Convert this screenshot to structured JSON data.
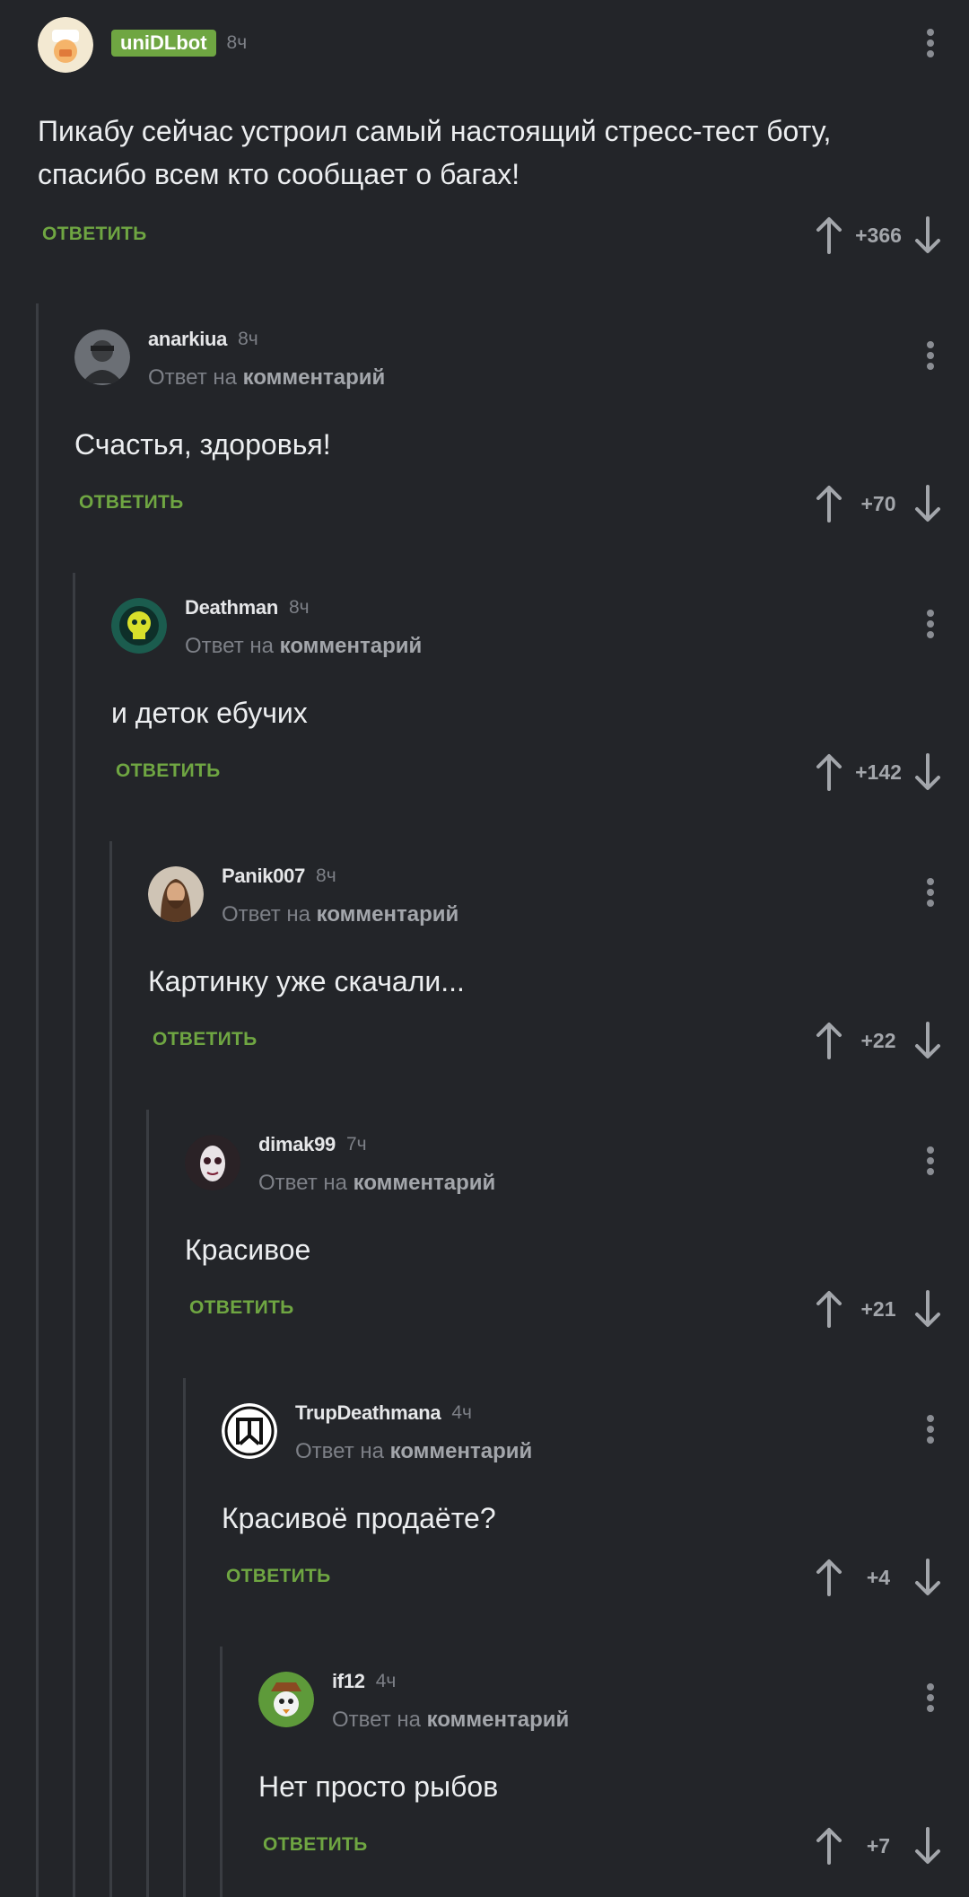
{
  "reply_label": "ОТВЕТИТЬ",
  "reply_to_prefix": "Ответ на",
  "reply_to_link": "комментарий",
  "comments": [
    {
      "author": "uniDLbot",
      "time": "8ч",
      "text": "Пикабу сейчас устроил самый настоящий стресс-тест боту,\nспасибо всем кто сообщает о багах!",
      "rating": "+366",
      "is_badge": true
    },
    {
      "author": "anarkiua",
      "time": "8ч",
      "text": "Счастья, здоровья!",
      "rating": "+70"
    },
    {
      "author": "Deathman",
      "time": "8ч",
      "text": "и деток ебучих",
      "rating": "+142"
    },
    {
      "author": "Panik007",
      "time": "8ч",
      "text": "Картинку уже скачали...",
      "rating": "+22"
    },
    {
      "author": "dimak99",
      "time": "7ч",
      "text": "Красивое",
      "rating": "+21"
    },
    {
      "author": "TrupDeathmana",
      "time": "4ч",
      "text": "Красивоё продаёте?",
      "rating": "+4"
    },
    {
      "author": "if12",
      "time": "4ч",
      "text": "Нет просто рыбов",
      "rating": "+7"
    }
  ],
  "colors": {
    "background": "#232529",
    "accent_green": "#6fa642",
    "thread_line": "#3a3d42",
    "muted_text": "#7d8087"
  },
  "icons": [
    "upvote-arrow-icon",
    "downvote-arrow-icon",
    "more-vertical-icon",
    "avatar-image"
  ]
}
